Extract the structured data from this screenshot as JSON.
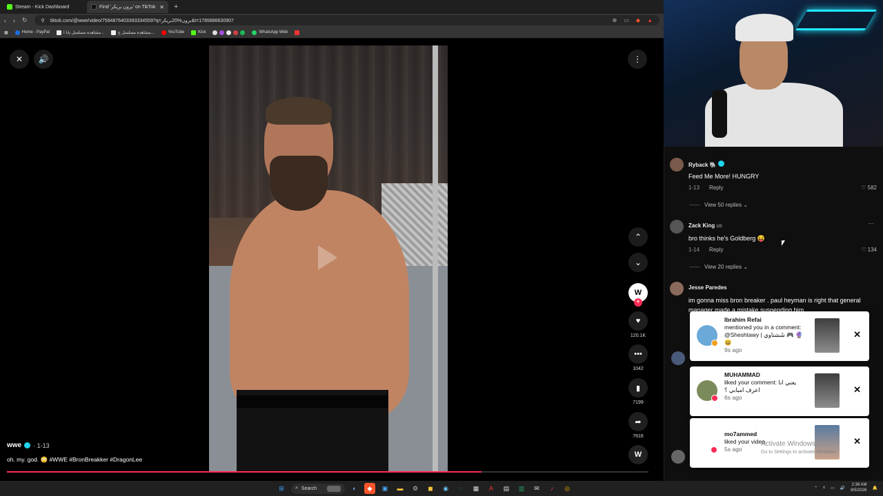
{
  "browser": {
    "tabs": [
      {
        "label": "Stream - Kick Dashboard",
        "active": false
      },
      {
        "label": "Find 'برون بريكر' on TikTok | TikTo",
        "active": true
      }
    ],
    "url": "tiktok.com/@wwe/video/7594876403393334559?q=برون%20بريكر&t=1785886630907",
    "bookmarks": [
      "Home - PayPal",
      "مشاهدة مسلسل بابا ا...",
      "مشاهدة مسلسل ج...",
      "YouTube",
      "Kick",
      "WhatsApp Web"
    ]
  },
  "video": {
    "author": "wwe",
    "date": "· 1-13",
    "description": "oh. my. god. 😳 #WWE #BronBreakker #DragonLee",
    "progress": 0.74
  },
  "actions": {
    "likes": "120.1K",
    "comments": "1042",
    "saves": "7199",
    "shares": "7616"
  },
  "comments": [
    {
      "name": "Ryback",
      "text": "Feed Me More! HUNGRY",
      "date": "1-13",
      "reply": "Reply",
      "likes": "582",
      "view_replies": "View 50 replies ⌄"
    },
    {
      "name": "Zack King",
      "tag": "us",
      "text": "bro thinks he's Goldberg 😝",
      "date": "1-14",
      "reply": "Reply",
      "likes": "134",
      "view_replies": "View 20 replies ⌄"
    },
    {
      "name": "Jesse Paredes",
      "text": "im gonna miss bron breaker . paul heyman is right that general manager made a mistake suspending him"
    }
  ],
  "notifications": [
    {
      "name": "Ibrahim Refai",
      "text": "mentioned you in a comment: @Sheshtawy | شَشتاوي 🎮 🔮 😆",
      "ago": "9s ago",
      "badge_color": "#f0a020"
    },
    {
      "name": "MUHAMMAD",
      "text": "liked your comment: يعني انا اعرف امبابي ؟",
      "ago": "6s ago",
      "badge_color": "#fe2c55"
    },
    {
      "name": "mo7ammed",
      "text": "liked your video.",
      "ago": "5s ago",
      "badge_color": "#fe2c55"
    }
  ],
  "watermark": {
    "line1": "Activate Windows",
    "line2": "Go to Settings to activate Windows."
  },
  "taskbar": {
    "search_label": "Search",
    "time": "2:38 AM",
    "date": "8/5/2026"
  },
  "colors": {
    "accent": "#fe2c55",
    "verified": "#20d5ec"
  }
}
